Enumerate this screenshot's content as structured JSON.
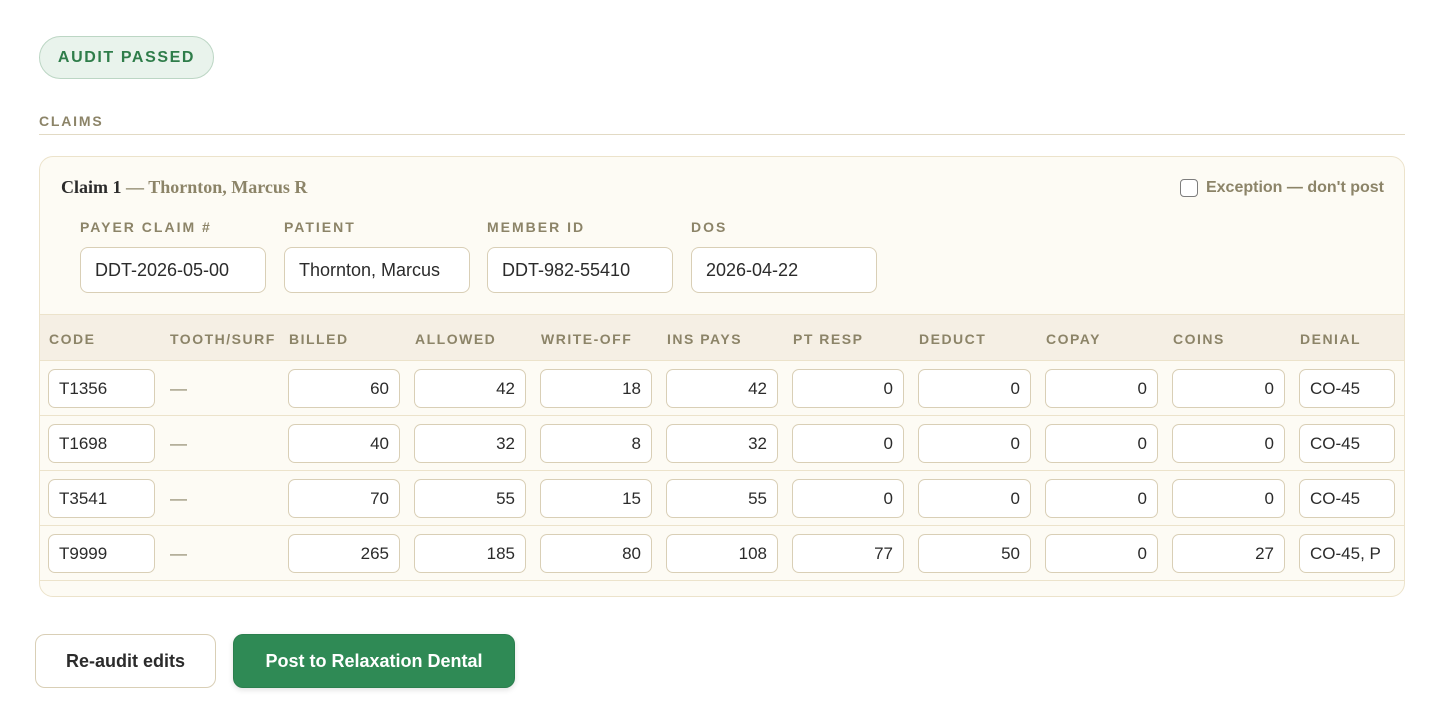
{
  "status": {
    "label": "AUDIT PASSED"
  },
  "section": {
    "label": "CLAIMS"
  },
  "claim": {
    "title": "Claim 1",
    "separator": " — ",
    "patient_display": "Thornton, Marcus R",
    "exception_label": "Exception — don't post",
    "exception_checked": false,
    "fields": {
      "payer_claim_label": "PAYER CLAIM #",
      "payer_claim_value": "DDT-2026-05-00",
      "patient_label": "PATIENT",
      "patient_value": "Thornton, Marcus",
      "member_id_label": "MEMBER ID",
      "member_id_value": "DDT-982-55410",
      "dos_label": "DOS",
      "dos_value": "2026-04-22"
    },
    "columns": [
      "CODE",
      "TOOTH/SURF",
      "BILLED",
      "ALLOWED",
      "WRITE-OFF",
      "INS PAYS",
      "PT RESP",
      "DEDUCT",
      "COPAY",
      "COINS",
      "DENIAL"
    ],
    "lines": [
      {
        "code": "T1356",
        "tooth": "—",
        "billed": "60",
        "allowed": "42",
        "writeoff": "18",
        "ins_pays": "42",
        "pt_resp": "0",
        "deduct": "0",
        "copay": "0",
        "coins": "0",
        "denial": "CO-45"
      },
      {
        "code": "T1698",
        "tooth": "—",
        "billed": "40",
        "allowed": "32",
        "writeoff": "8",
        "ins_pays": "32",
        "pt_resp": "0",
        "deduct": "0",
        "copay": "0",
        "coins": "0",
        "denial": "CO-45"
      },
      {
        "code": "T3541",
        "tooth": "—",
        "billed": "70",
        "allowed": "55",
        "writeoff": "15",
        "ins_pays": "55",
        "pt_resp": "0",
        "deduct": "0",
        "copay": "0",
        "coins": "0",
        "denial": "CO-45"
      },
      {
        "code": "T9999",
        "tooth": "—",
        "billed": "265",
        "allowed": "185",
        "writeoff": "80",
        "ins_pays": "108",
        "pt_resp": "77",
        "deduct": "50",
        "copay": "0",
        "coins": "27",
        "denial": "CO-45, P"
      }
    ]
  },
  "actions": {
    "reaudit_label": "Re-audit edits",
    "post_label": "Post to Relaxation Dental"
  },
  "colors": {
    "accent_green": "#2f8a55",
    "label_tan": "#8c8468",
    "card_bg": "#fdfbf4",
    "header_bg": "#f5efe4"
  }
}
